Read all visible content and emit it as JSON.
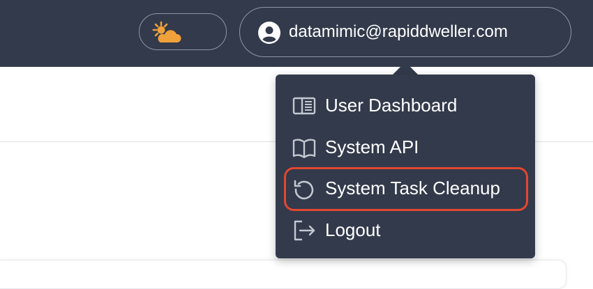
{
  "header": {
    "theme_toggle": {
      "icon": "sun-cloud-icon",
      "icon_color": "#f0a13a"
    },
    "user": {
      "email": "datamimic@rapiddweller.com",
      "icon": "user-avatar-icon"
    }
  },
  "user_menu": {
    "items": [
      {
        "label": "User Dashboard",
        "icon": "dashboard-icon"
      },
      {
        "label": "System API",
        "icon": "book-icon"
      },
      {
        "label": "System Task Cleanup",
        "icon": "refresh-icon",
        "highlighted": true
      },
      {
        "label": "Logout",
        "icon": "logout-icon"
      }
    ],
    "highlight_color": "#e2472f"
  },
  "colors": {
    "topbar": "#333a4b",
    "text": "#ffffff",
    "icon_gray": "#c3c8d1"
  }
}
